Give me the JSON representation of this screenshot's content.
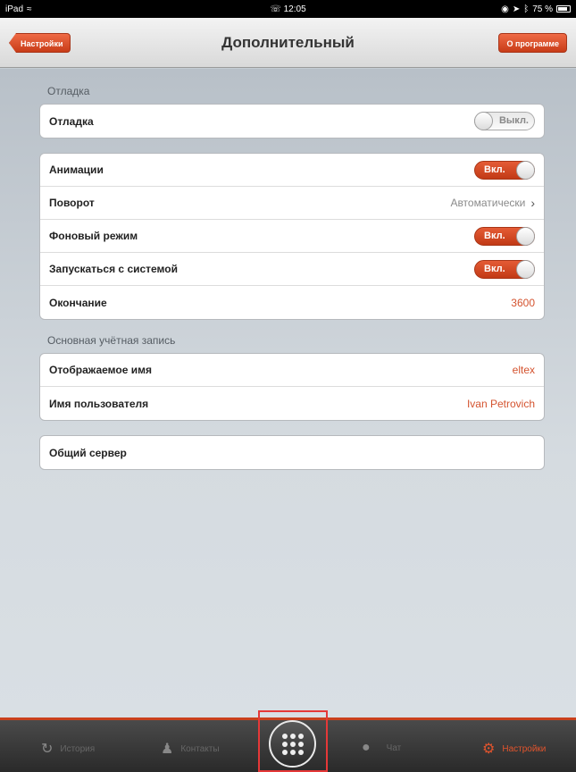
{
  "statusbar": {
    "device": "iPad",
    "time": "12:05",
    "battery": "75 %"
  },
  "navbar": {
    "back_label": "Настройки",
    "title": "Дополнительный",
    "about_label": "О программе"
  },
  "sections": {
    "debug_header": "Отладка",
    "account_header": "Основная учётная запись"
  },
  "debug": {
    "label": "Отладка",
    "toggle_text": "Выкл.",
    "toggle_state": "off"
  },
  "general": {
    "animation": {
      "label": "Анимации",
      "toggle_text": "Вкл.",
      "toggle_state": "on"
    },
    "rotation": {
      "label": "Поворот",
      "value": "Автоматически"
    },
    "background": {
      "label": "Фоновый режим",
      "toggle_text": "Вкл.",
      "toggle_state": "on"
    },
    "autostart": {
      "label": "Запускаться с системой",
      "toggle_text": "Вкл.",
      "toggle_state": "on"
    },
    "timeout": {
      "label": "Окончание",
      "value": "3600"
    }
  },
  "account": {
    "display_name": {
      "label": "Отображаемое имя",
      "value": "eltex"
    },
    "username": {
      "label": "Имя пользователя",
      "value": "Ivan Petrovich"
    }
  },
  "shared_server": {
    "label": "Общий сервер"
  },
  "tabbar": {
    "history": "История",
    "contacts": "Контакты",
    "chat": "Чат",
    "settings": "Настройки"
  },
  "colors": {
    "accent": "#d4532f",
    "toggle_on": "#c23a16"
  }
}
